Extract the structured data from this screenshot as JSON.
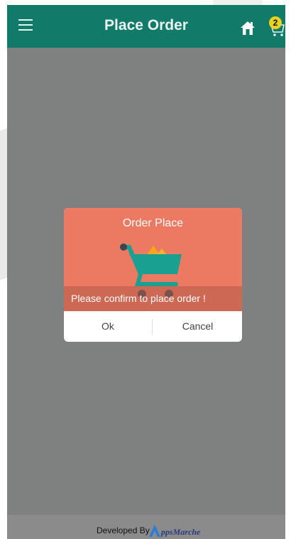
{
  "header": {
    "title": "Place Order",
    "cart_count": "2"
  },
  "dialog": {
    "title": "Order Place",
    "message": "Please confirm to place order !",
    "ok_label": "Ok",
    "cancel_label": "Cancel"
  },
  "footer": {
    "developed_by": "Developed By",
    "brand": "ppsMarche"
  },
  "colors": {
    "toolbar": "#127a68",
    "dialog": "#ec7a63",
    "overlay": "#7f8181",
    "badge": "#e8d21e"
  },
  "icons": [
    "menu-icon",
    "home-icon",
    "cart-icon",
    "shopping-cart-illustration",
    "appsmarche-logo-icon"
  ]
}
